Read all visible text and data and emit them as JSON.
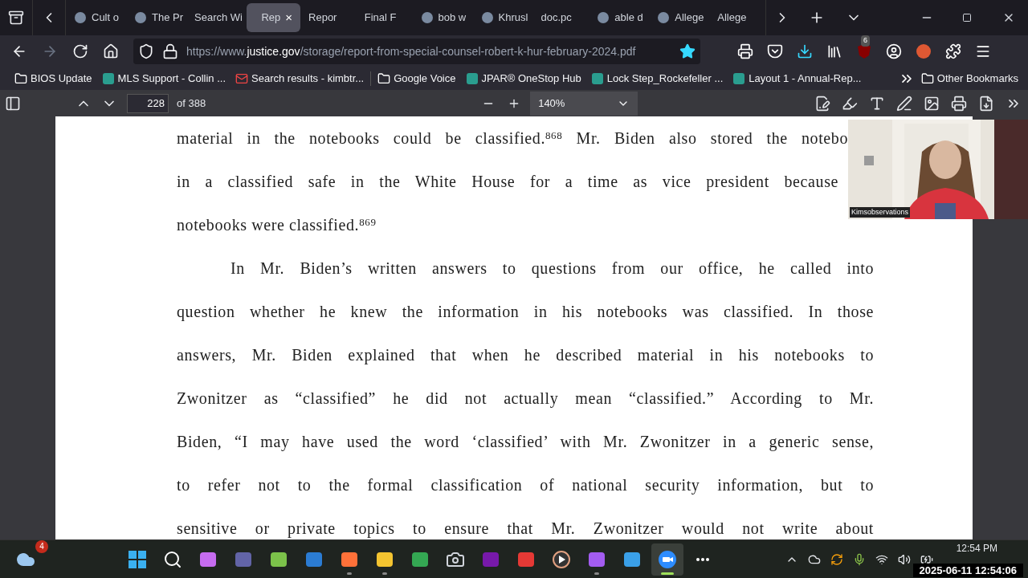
{
  "tabs": [
    {
      "label": "Cult o",
      "kind": "favicon",
      "selected": false
    },
    {
      "label": "The Pr",
      "kind": "favicon",
      "selected": false
    },
    {
      "label": "Search Wi",
      "kind": "plain",
      "selected": false
    },
    {
      "label": "Rep",
      "kind": "plain",
      "selected": true,
      "close": "×"
    },
    {
      "label": "Repor",
      "kind": "plain",
      "selected": false
    },
    {
      "label": "Final F",
      "kind": "plain",
      "selected": false
    },
    {
      "label": "bob w",
      "kind": "favicon",
      "selected": false
    },
    {
      "label": "Khrusl",
      "kind": "favicon",
      "selected": false
    },
    {
      "label": "doc.pc",
      "kind": "plain",
      "selected": false
    },
    {
      "label": "able d",
      "kind": "favicon",
      "selected": false
    },
    {
      "label": "Allege",
      "kind": "favicon",
      "selected": false
    },
    {
      "label": "Allege",
      "kind": "plain",
      "selected": false
    }
  ],
  "address_bar": {
    "prefix": "https://www.",
    "domain": "justice.gov",
    "path": "/storage/report-from-special-counsel-robert-k-hur-february-2024.pdf",
    "bookmarked": true
  },
  "extension_badge": "6",
  "bookmarks": [
    {
      "label": "BIOS Update",
      "kind": "folder"
    },
    {
      "label": "MLS Support - Collin ...",
      "kind": "site"
    },
    {
      "label": "Search results - kimbtr...",
      "kind": "mail"
    },
    {
      "label": "Google Voice",
      "kind": "folder"
    },
    {
      "label": "JPAR® OneStop Hub",
      "kind": "site"
    },
    {
      "label": "Lock Step_Rockefeller ...",
      "kind": "site"
    },
    {
      "label": "Layout 1 - Annual-Rep...",
      "kind": "site"
    }
  ],
  "other_bookmarks": "Other Bookmarks",
  "pdf_toolbar": {
    "page": "228",
    "page_count": "of 388",
    "zoom": "140%"
  },
  "document_lines": [
    {
      "text": "material in the notebooks could be classified.$^{868}$ Mr. Biden also stored the notebo",
      "kind": "cut"
    },
    {
      "text": "in a classified safe in the White House for a time as vice president because",
      "kind": "cut2"
    },
    {
      "text": "notebooks were classified.$^{869}$",
      "kind": "last"
    },
    {
      "text": "In Mr. Biden’s written answers to questions from our office, he called into",
      "kind": "indent"
    },
    {
      "text": "question whether he knew the information in his notebooks was classified. In those",
      "kind": "full"
    },
    {
      "text": "answers, Mr. Biden explained that when he described material in his notebooks to",
      "kind": "full"
    },
    {
      "text": "Zwonitzer as “classified” he did not actually mean “classified.” According to Mr.",
      "kind": "full"
    },
    {
      "text": "Biden, “I may have used the word ‘classified’ with Mr. Zwonitzer in a generic sense,",
      "kind": "full"
    },
    {
      "text": "to refer not to the formal classification of national security information, but to",
      "kind": "full"
    },
    {
      "text": "sensitive or private topics to ensure that Mr. Zwonitzer would not write about",
      "kind": "full"
    }
  ],
  "video_overlay": {
    "name": "Kimsobservations"
  },
  "taskbar": {
    "weather_badge": "4",
    "apps": [
      {
        "kind": "start",
        "running": false,
        "selected": false
      },
      {
        "kind": "search",
        "running": false,
        "selected": false
      },
      {
        "kind": "copilot",
        "running": false,
        "selected": false
      },
      {
        "kind": "teams",
        "running": false,
        "selected": false
      },
      {
        "kind": "c-app",
        "running": false,
        "selected": false
      },
      {
        "kind": "word",
        "running": false,
        "selected": false
      },
      {
        "kind": "firefox",
        "running": true,
        "selected": false
      },
      {
        "kind": "files",
        "running": true,
        "selected": false
      },
      {
        "kind": "chrome",
        "running": false,
        "selected": false
      },
      {
        "kind": "camera",
        "running": false,
        "selected": false
      },
      {
        "kind": "onenote",
        "running": false,
        "selected": false
      },
      {
        "kind": "audio",
        "running": false,
        "selected": false
      },
      {
        "kind": "player",
        "running": false,
        "selected": false
      },
      {
        "kind": "clapper",
        "running": true,
        "selected": false
      },
      {
        "kind": "photos",
        "running": false,
        "selected": false
      },
      {
        "kind": "zoom",
        "running": true,
        "selected": true
      },
      {
        "kind": "more",
        "running": false,
        "selected": false
      }
    ],
    "clock": "12:54 PM"
  },
  "recording_timestamp": "2025-06-11 12:54:06"
}
